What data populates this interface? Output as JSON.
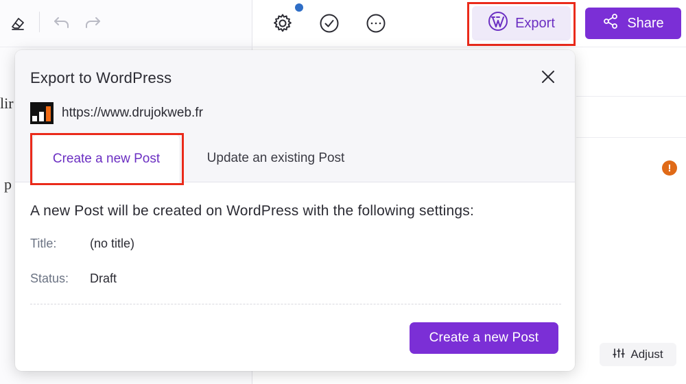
{
  "toolbar": {
    "export_label": "Export",
    "share_label": "Share",
    "icons": [
      "eraser-icon",
      "undo-icon",
      "redo-icon",
      "gear-icon",
      "check-circle-icon",
      "more-icon",
      "wordpress-icon",
      "share-icon"
    ]
  },
  "background": {
    "left_text_1": "lir",
    "left_text_2": "p",
    "warning_glyph": "!",
    "adjust_label": "Adjust"
  },
  "modal": {
    "title": "Export to WordPress",
    "site_url": "https://www.drujokweb.fr",
    "tabs": [
      {
        "label": "Create a new Post",
        "active": true
      },
      {
        "label": "Update an existing Post",
        "active": false
      }
    ],
    "description": "A new Post will be created on WordPress with the following settings:",
    "fields": [
      {
        "label": "Title:",
        "value": "(no title)"
      },
      {
        "label": "Status:",
        "value": "Draft"
      }
    ],
    "primary_button": "Create a new Post"
  },
  "colors": {
    "accent": "#7b2fd6",
    "accent_text": "#6b2fc2",
    "highlight": "#ea2a1a",
    "warning": "#e06a17",
    "notification_dot": "#2f6ec6"
  }
}
